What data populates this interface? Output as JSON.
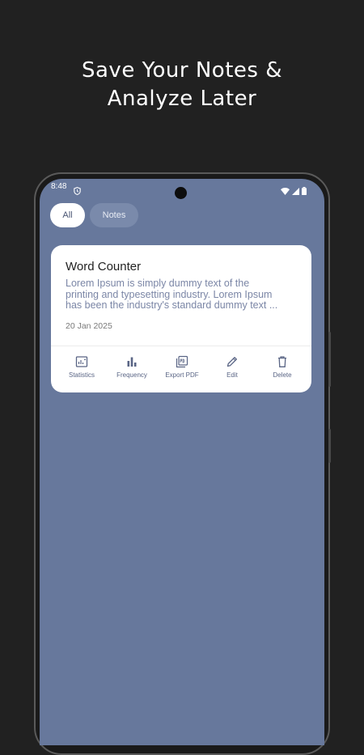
{
  "headline": {
    "line1": "Save Your Notes &",
    "line2": "Analyze Later"
  },
  "status_bar": {
    "time": "8:48"
  },
  "filters": {
    "all_label": "All",
    "notes_label": "Notes",
    "selected": "All"
  },
  "note_card": {
    "title": "Word Counter",
    "body_lines": [
      "Lorem Ipsum is simply dummy text of the",
      "printing and typesetting industry. Lorem Ipsum",
      "has been the industry's standard dummy text ..."
    ],
    "date": "20 Jan 2025",
    "actions": [
      {
        "label": "Statistics",
        "icon": "statistics-icon"
      },
      {
        "label": "Frequency",
        "icon": "bar-chart-icon"
      },
      {
        "label": "Export PDF",
        "icon": "pdf-icon"
      },
      {
        "label": "Edit",
        "icon": "pencil-icon"
      },
      {
        "label": "Delete",
        "icon": "trash-icon"
      }
    ]
  },
  "colors": {
    "background": "#212121",
    "screen": "#67789c",
    "card": "#ffffff",
    "accent": "#5a6585"
  }
}
